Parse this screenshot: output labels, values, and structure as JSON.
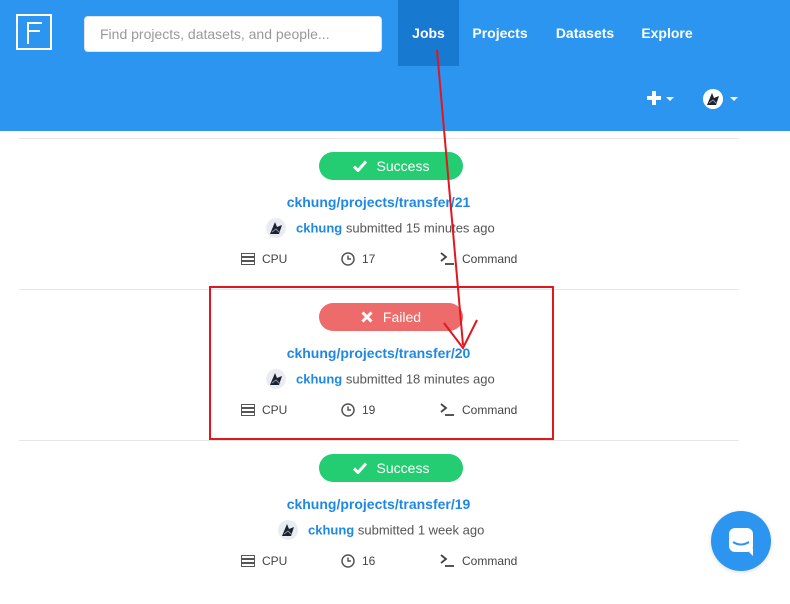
{
  "header": {
    "search_placeholder": "Find projects, datasets, and people...",
    "nav": {
      "jobs": "Jobs",
      "projects": "Projects",
      "datasets": "Datasets",
      "explore": "Explore"
    },
    "icons": [
      "logo-icon",
      "plus-icon",
      "avatar-icon"
    ],
    "active_tab": "Jobs"
  },
  "colors": {
    "header_bg": "#2b95f0",
    "active_tab_bg": "#1879d0",
    "success": "#24cc72",
    "failed": "#ee6b6b",
    "link": "#1e88e5",
    "annotation": "#e1161e"
  },
  "jobs": [
    {
      "status": "Success",
      "title": "ckhung/projects/transfer/21",
      "user": "ckhung",
      "submitted": "submitted 15 minutes ago",
      "machine": "CPU",
      "duration": "17",
      "mode": "Command"
    },
    {
      "status": "Failed",
      "title": "ckhung/projects/transfer/20",
      "user": "ckhung",
      "submitted": "submitted 18 minutes ago",
      "machine": "CPU",
      "duration": "19",
      "mode": "Command"
    },
    {
      "status": "Success",
      "title": "ckhung/projects/transfer/19",
      "user": "ckhung",
      "submitted": "submitted 1 week ago",
      "machine": "CPU",
      "duration": "16",
      "mode": "Command"
    }
  ]
}
